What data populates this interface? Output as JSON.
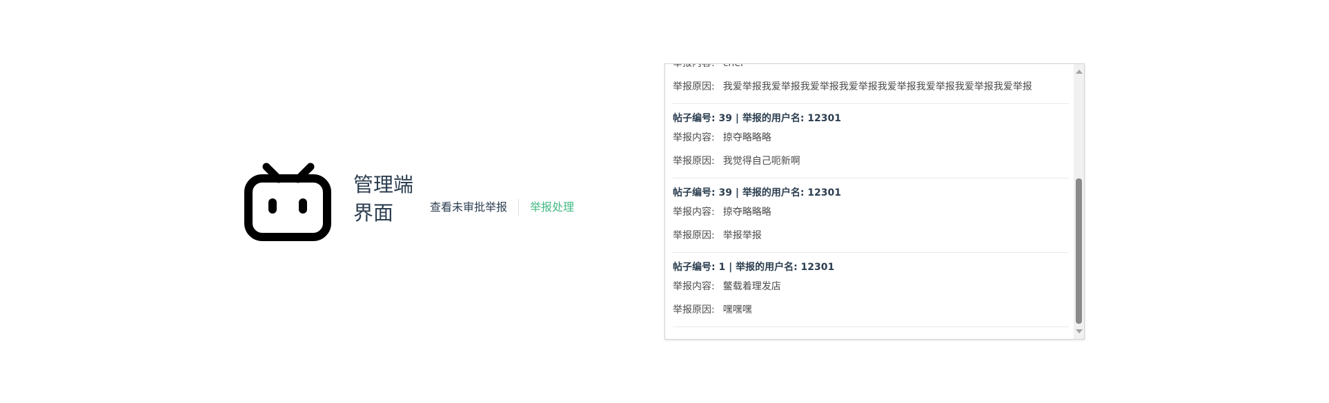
{
  "header": {
    "logo_icon": "bilibili-tv-icon",
    "title": "管理端界面"
  },
  "nav": {
    "pending_label": "查看未审批举报",
    "handle_label": "举报处理",
    "active_color": "#42b983"
  },
  "reports": [
    {
      "head": "",
      "content_label": "举报内容:",
      "content": "chef",
      "reason_label": "举报原因:",
      "reason": "我爱举报我爱举报我爱举报我爱举报我爱举报我爱举报我爱举报我爱举报"
    },
    {
      "head": "帖子编号: 39 | 举报的用户名: 12301",
      "content_label": "举报内容:",
      "content": "掠夺略略略",
      "reason_label": "举报原因:",
      "reason": "我觉得自己呃新啊"
    },
    {
      "head": "帖子编号: 39 | 举报的用户名: 12301",
      "content_label": "举报内容:",
      "content": "掠夺略略略",
      "reason_label": "举报原因:",
      "reason": "举报举报"
    },
    {
      "head": "帖子编号: 1 | 举报的用户名: 12301",
      "content_label": "举报内容:",
      "content": "鳖载着理发店",
      "reason_label": "举报原因:",
      "reason": "嘿嘿嘿"
    }
  ],
  "scrollbar": {
    "position_fraction": 0.55
  }
}
